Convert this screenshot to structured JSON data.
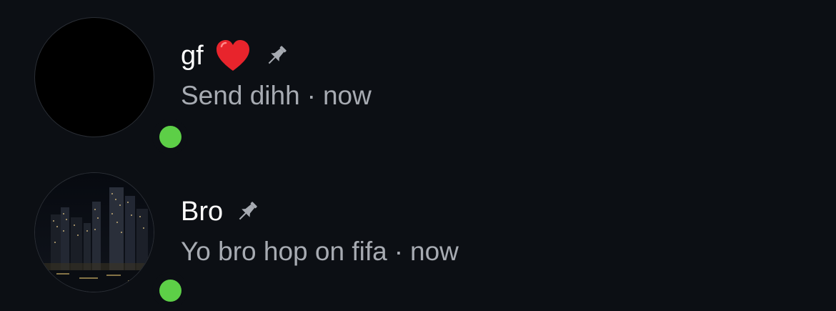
{
  "chats": [
    {
      "name": "gf",
      "has_heart": true,
      "pinned": true,
      "online": true,
      "message": "Send dihh",
      "separator": "·",
      "time": "now"
    },
    {
      "name": "Bro",
      "has_heart": false,
      "pinned": true,
      "online": true,
      "message": "Yo bro hop on fifa",
      "separator": "·",
      "time": "now"
    }
  ],
  "colors": {
    "background": "#0c0f14",
    "online": "#5dcf47",
    "secondary_text": "#a7abb2",
    "heart": "#e8242c"
  },
  "icons": {
    "heart": "red-heart-icon",
    "pin": "pin-icon"
  }
}
